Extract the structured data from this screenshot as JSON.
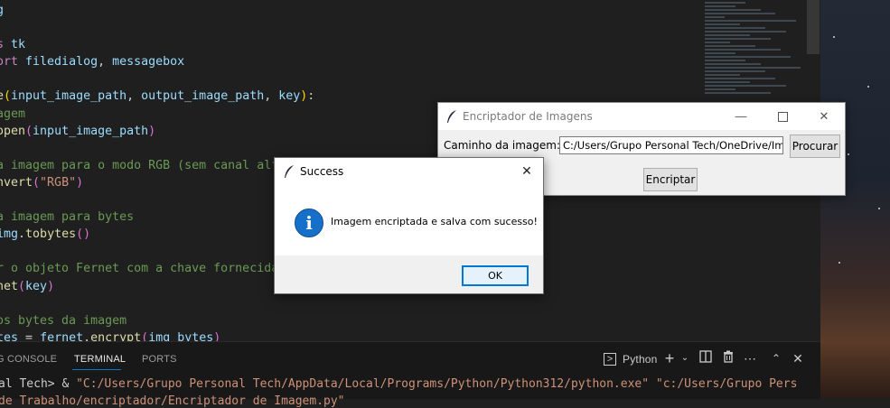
{
  "editor": {
    "lines": [
      [
        {
          "t": "g",
          "c": "va"
        }
      ],
      [],
      [
        {
          "t": "s ",
          "c": "kw"
        },
        {
          "t": "tk",
          "c": "va"
        }
      ],
      [
        {
          "t": "ort ",
          "c": "kw"
        },
        {
          "t": "filedialog",
          "c": "va"
        },
        {
          "t": ", ",
          "c": ""
        },
        {
          "t": "messagebox",
          "c": "va"
        }
      ],
      [],
      [
        {
          "t": "e",
          "c": "fn"
        },
        {
          "t": "(",
          "c": "pa"
        },
        {
          "t": "input_image_path",
          "c": "va"
        },
        {
          "t": ", ",
          "c": ""
        },
        {
          "t": "output_image_path",
          "c": "va"
        },
        {
          "t": ", ",
          "c": ""
        },
        {
          "t": "key",
          "c": "va"
        },
        {
          "t": ")",
          "c": "pa"
        },
        {
          "t": ":",
          "c": ""
        }
      ],
      [
        {
          "t": "agem",
          "c": "cm"
        }
      ],
      [
        {
          "t": "open",
          "c": "fn"
        },
        {
          "t": "(",
          "c": "pb"
        },
        {
          "t": "input_image_path",
          "c": "va"
        },
        {
          "t": ")",
          "c": "pb"
        }
      ],
      [],
      [
        {
          "t": "a imagem para o modo RGB (sem canal alfa)",
          "c": "cm"
        }
      ],
      [
        {
          "t": "nvert",
          "c": "fn"
        },
        {
          "t": "(",
          "c": "pb"
        },
        {
          "t": "\"RGB\"",
          "c": "st"
        },
        {
          "t": ")",
          "c": "pb"
        }
      ],
      [],
      [
        {
          "t": "a imagem para bytes",
          "c": "cm"
        }
      ],
      [
        {
          "t": "img",
          "c": "va"
        },
        {
          "t": ".",
          "c": ""
        },
        {
          "t": "tobytes",
          "c": "fn"
        },
        {
          "t": "()",
          "c": "pb"
        }
      ],
      [],
      [
        {
          "t": "r o objeto Fernet com a chave fornecida",
          "c": "cm"
        }
      ],
      [
        {
          "t": "net",
          "c": "fn"
        },
        {
          "t": "(",
          "c": "pb"
        },
        {
          "t": "key",
          "c": "va"
        },
        {
          "t": ")",
          "c": "pb"
        }
      ],
      [],
      [
        {
          "t": "os bytes da imagem",
          "c": "cm"
        }
      ],
      [
        {
          "t": "tes",
          "c": "va"
        },
        {
          "t": " = ",
          "c": ""
        },
        {
          "t": "fernet",
          "c": "va"
        },
        {
          "t": ".",
          "c": ""
        },
        {
          "t": "encrypt",
          "c": "fn"
        },
        {
          "t": "(",
          "c": "pb"
        },
        {
          "t": "img_bytes",
          "c": "va"
        },
        {
          "t": ")",
          "c": "pb"
        }
      ]
    ]
  },
  "panel": {
    "tabs": [
      {
        "label": "G CONSOLE",
        "active": false
      },
      {
        "label": "TERMINAL",
        "active": true
      },
      {
        "label": "PORTS",
        "active": false
      }
    ],
    "terminal_name": "Python",
    "terminal_prompt": "al Tech> & ",
    "terminal_path": "\"C:/Users/Grupo Personal Tech/AppData/Local/Programs/Python/Python312/python.exe\" \"c:/Users/Grupo Pers",
    "terminal_line2": "de Trabalho/encriptador/Encriptador de Imagem.py\""
  },
  "main_window": {
    "title": "Encriptador de Imagens",
    "path_label": "Caminho da imagem:",
    "path_value": "C:/Users/Grupo Personal Tech/OneDrive/Imagens/",
    "browse_label": "Procurar",
    "encrypt_label": "Encriptar"
  },
  "dialog": {
    "title": "Success",
    "message": "Imagem encriptada e salva com sucesso!",
    "ok_label": "OK",
    "icon": "info-icon"
  },
  "colors": {
    "editor_bg": "#1f1f1f",
    "accent": "#0078d4",
    "info_blue": "#1670c9"
  }
}
